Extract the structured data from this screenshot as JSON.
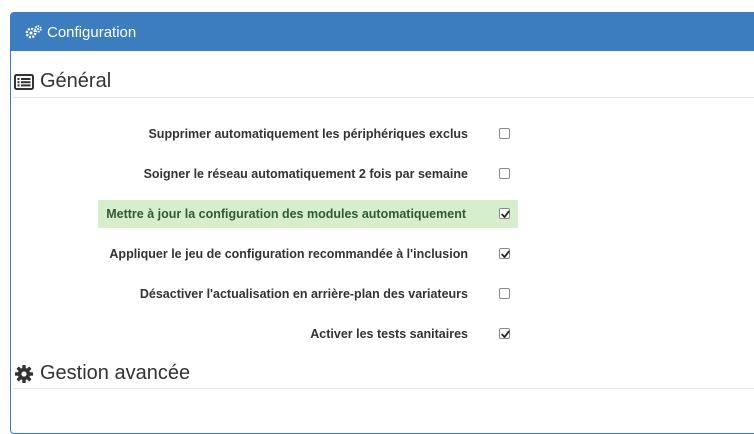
{
  "panel": {
    "title": "Configuration",
    "icon": "gears-icon",
    "header_color": "#3c7dc0"
  },
  "sections": {
    "general": {
      "title": "Général",
      "icon": "list-alt-icon"
    },
    "advanced": {
      "title": "Gestion avancée",
      "icon": "gear-icon"
    }
  },
  "options": [
    {
      "label": "Supprimer automatiquement les périphériques exclus",
      "checked": false,
      "highlighted": false
    },
    {
      "label": "Soigner le réseau automatiquement 2 fois par semaine",
      "checked": false,
      "highlighted": false
    },
    {
      "label": "Mettre à jour la configuration des modules automatiquement",
      "checked": true,
      "highlighted": true
    },
    {
      "label": "Appliquer le jeu de configuration recommandée à l'inclusion",
      "checked": true,
      "highlighted": false
    },
    {
      "label": "Désactiver l'actualisation en arrière-plan des variateurs",
      "checked": false,
      "highlighted": false
    },
    {
      "label": "Activer les tests sanitaires",
      "checked": true,
      "highlighted": false
    }
  ],
  "colors": {
    "highlight_bg": "#d7eecd",
    "text": "#333333"
  }
}
